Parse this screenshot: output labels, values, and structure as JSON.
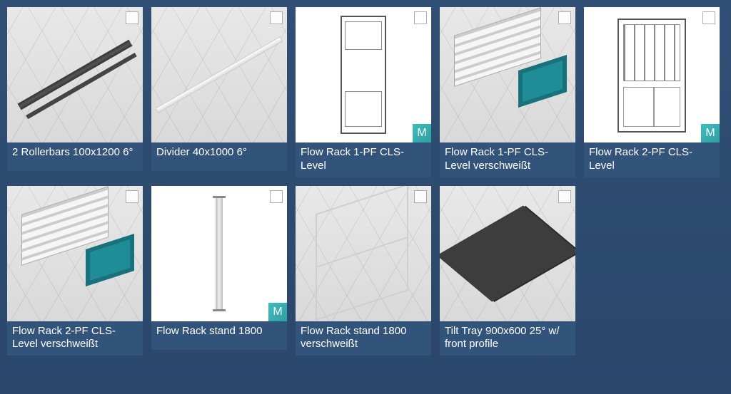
{
  "gallery": {
    "items": [
      {
        "label": "2 Rollerbars 100x1200 6°",
        "thumb_style": "iso",
        "deco": "rollerbars",
        "has_m_badge": false
      },
      {
        "label": "Divider 40x1000 6°",
        "thumb_style": "iso",
        "deco": "divider",
        "has_m_badge": false
      },
      {
        "label": "Flow Rack 1-PF CLS-Level",
        "thumb_style": "white",
        "deco": "rackfront",
        "has_m_badge": true
      },
      {
        "label": "Flow Rack 1-PF CLS-Level verschweißt",
        "thumb_style": "iso",
        "deco": "rackiso",
        "has_m_badge": false
      },
      {
        "label": "Flow Rack 2-PF CLS-Level",
        "thumb_style": "white",
        "deco": "rack2front",
        "has_m_badge": true
      },
      {
        "label": "Flow Rack 2-PF CLS-Level verschweißt",
        "thumb_style": "iso",
        "deco": "rackiso",
        "has_m_badge": false
      },
      {
        "label": "Flow Rack stand 1800",
        "thumb_style": "white",
        "deco": "standfront",
        "has_m_badge": true
      },
      {
        "label": "Flow Rack stand 1800 verschweißt",
        "thumb_style": "iso",
        "deco": "standiso",
        "has_m_badge": false
      },
      {
        "label": "Tilt Tray 900x600 25° w/ front profile",
        "thumb_style": "iso",
        "deco": "tray",
        "has_m_badge": false
      }
    ]
  },
  "badge_letter": "M"
}
